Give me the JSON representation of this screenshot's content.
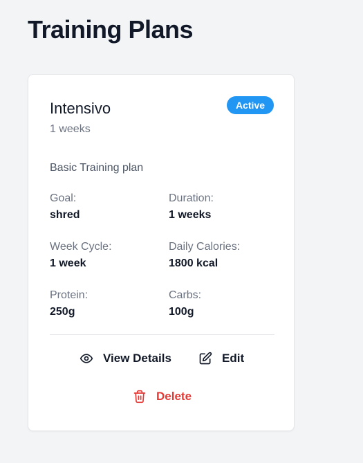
{
  "page": {
    "title": "Training Plans"
  },
  "plan": {
    "name": "Intensivo",
    "status": "Active",
    "length": "1 weeks",
    "description": "Basic Training plan",
    "stats": [
      {
        "label": "Goal:",
        "value": "shred"
      },
      {
        "label": "Duration:",
        "value": "1 weeks"
      },
      {
        "label": "Week Cycle:",
        "value": "1 week"
      },
      {
        "label": "Daily Calories:",
        "value": "1800 kcal"
      },
      {
        "label": "Protein:",
        "value": "250g"
      },
      {
        "label": "Carbs:",
        "value": "100g"
      }
    ],
    "actions": {
      "view_label": "View Details",
      "view_icon": "eye-icon",
      "edit_label": "Edit",
      "edit_icon": "edit-icon",
      "delete_label": "Delete",
      "delete_icon": "trash-icon"
    }
  },
  "colors": {
    "accent": "#2196f3",
    "danger": "#e53935",
    "background": "#f3f4f6",
    "card": "#ffffff"
  }
}
